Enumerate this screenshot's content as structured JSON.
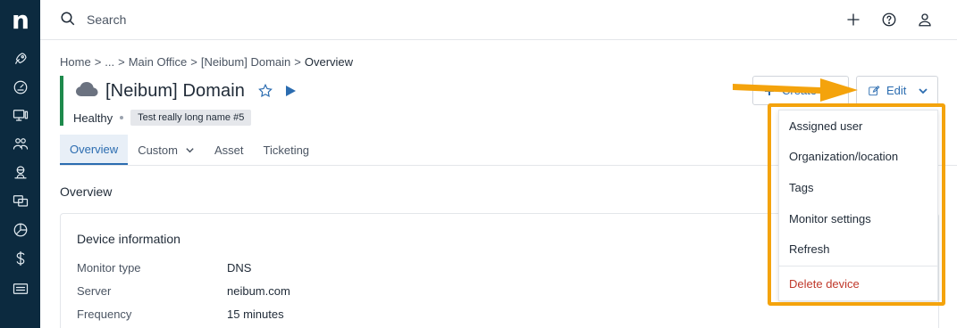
{
  "sidebar": {
    "logo": "n",
    "items": [
      {
        "icon": "rocket-icon"
      },
      {
        "icon": "gauge-icon"
      },
      {
        "icon": "devices-icon"
      },
      {
        "icon": "users-icon"
      },
      {
        "icon": "technician-icon"
      },
      {
        "icon": "remote-icon"
      },
      {
        "icon": "reports-icon"
      },
      {
        "icon": "dollar-icon"
      },
      {
        "icon": "ticket-icon"
      }
    ]
  },
  "topbar": {
    "search_placeholder": "Search",
    "icons": [
      "plus-icon",
      "help-icon",
      "user-icon"
    ]
  },
  "breadcrumb": {
    "items": [
      "Home",
      "...",
      "Main Office",
      "[Neibum] Domain"
    ],
    "separator": ">",
    "current": "Overview"
  },
  "header": {
    "title": "[Neibum] Domain",
    "status": "Healthy",
    "tag": "Test really long name #5",
    "accent_color": "#1e8a4c"
  },
  "actions": {
    "create_label": "Create",
    "edit_label": "Edit"
  },
  "tabs": [
    {
      "label": "Overview",
      "active": true
    },
    {
      "label": "Custom",
      "active": false,
      "has_dropdown": true
    },
    {
      "label": "Asset",
      "active": false
    },
    {
      "label": "Ticketing",
      "active": false
    }
  ],
  "section": {
    "title": "Overview"
  },
  "device_info": {
    "title": "Device information",
    "rows": [
      {
        "label": "Monitor type",
        "value": "DNS"
      },
      {
        "label": "Server",
        "value": "neibum.com"
      },
      {
        "label": "Frequency",
        "value": "15 minutes"
      }
    ]
  },
  "edit_menu": {
    "items": [
      "Assigned user",
      "Organization/location",
      "Tags",
      "Monitor settings",
      "Refresh"
    ],
    "danger_item": "Delete device",
    "highlight_color": "#f4a30c"
  }
}
